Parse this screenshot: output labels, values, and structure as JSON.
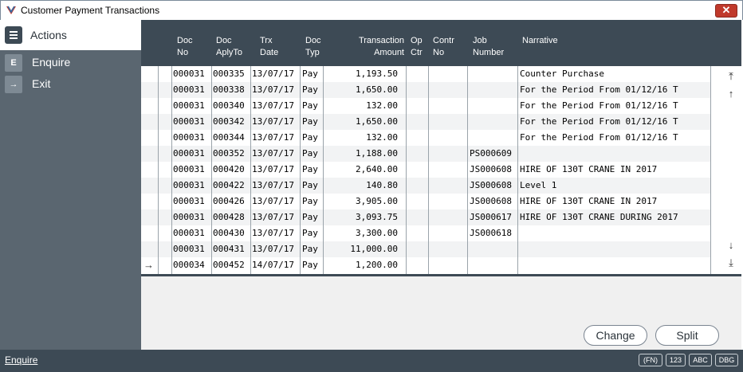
{
  "window": {
    "title": "Customer Payment Transactions",
    "close_glyph": "✕"
  },
  "sidebar": {
    "header": "Actions",
    "items": [
      {
        "label": "Enquire",
        "icon": "E"
      },
      {
        "label": "Exit",
        "icon": "→"
      }
    ]
  },
  "grid": {
    "columns": [
      {
        "line1": "Doc",
        "line2": "No"
      },
      {
        "line1": "Doc",
        "line2": "AplyTo"
      },
      {
        "line1": "Trx",
        "line2": "Date"
      },
      {
        "line1": "Doc",
        "line2": "Typ"
      },
      {
        "line1": "Transaction",
        "line2": "Amount"
      },
      {
        "line1": "Op",
        "line2": "Ctr"
      },
      {
        "line1": "Contr",
        "line2": "No"
      },
      {
        "line1": "Job",
        "line2": "Number"
      },
      {
        "line1": "Narrative",
        "line2": ""
      }
    ],
    "rows": [
      {
        "doc_no": "000031",
        "aply_to": "000335",
        "date": "13/07/17",
        "type": "Pay",
        "amount": "1,193.50",
        "op": "",
        "contr": "",
        "job": "",
        "narrative": "Counter Purchase"
      },
      {
        "doc_no": "000031",
        "aply_to": "000338",
        "date": "13/07/17",
        "type": "Pay",
        "amount": "1,650.00",
        "op": "",
        "contr": "",
        "job": "",
        "narrative": "For the Period From 01/12/16 T"
      },
      {
        "doc_no": "000031",
        "aply_to": "000340",
        "date": "13/07/17",
        "type": "Pay",
        "amount": "132.00",
        "op": "",
        "contr": "",
        "job": "",
        "narrative": "For the Period From 01/12/16 T"
      },
      {
        "doc_no": "000031",
        "aply_to": "000342",
        "date": "13/07/17",
        "type": "Pay",
        "amount": "1,650.00",
        "op": "",
        "contr": "",
        "job": "",
        "narrative": "For the Period From 01/12/16 T"
      },
      {
        "doc_no": "000031",
        "aply_to": "000344",
        "date": "13/07/17",
        "type": "Pay",
        "amount": "132.00",
        "op": "",
        "contr": "",
        "job": "",
        "narrative": "For the Period From 01/12/16 T"
      },
      {
        "doc_no": "000031",
        "aply_to": "000352",
        "date": "13/07/17",
        "type": "Pay",
        "amount": "1,188.00",
        "op": "",
        "contr": "",
        "job": "PS000609",
        "narrative": ""
      },
      {
        "doc_no": "000031",
        "aply_to": "000420",
        "date": "13/07/17",
        "type": "Pay",
        "amount": "2,640.00",
        "op": "",
        "contr": "",
        "job": "JS000608",
        "narrative": "HIRE OF 130T CRANE IN 2017"
      },
      {
        "doc_no": "000031",
        "aply_to": "000422",
        "date": "13/07/17",
        "type": "Pay",
        "amount": "140.80",
        "op": "",
        "contr": "",
        "job": "JS000608",
        "narrative": "Level 1"
      },
      {
        "doc_no": "000031",
        "aply_to": "000426",
        "date": "13/07/17",
        "type": "Pay",
        "amount": "3,905.00",
        "op": "",
        "contr": "",
        "job": "JS000608",
        "narrative": "HIRE OF 130T CRANE IN 2017"
      },
      {
        "doc_no": "000031",
        "aply_to": "000428",
        "date": "13/07/17",
        "type": "Pay",
        "amount": "3,093.75",
        "op": "",
        "contr": "",
        "job": "JS000617",
        "narrative": "HIRE OF 130T CRANE DURING 2017"
      },
      {
        "doc_no": "000031",
        "aply_to": "000430",
        "date": "13/07/17",
        "type": "Pay",
        "amount": "3,300.00",
        "op": "",
        "contr": "",
        "job": "JS000618",
        "narrative": ""
      },
      {
        "doc_no": "000031",
        "aply_to": "000431",
        "date": "13/07/17",
        "type": "Pay",
        "amount": "11,000.00",
        "op": "",
        "contr": "",
        "job": "",
        "narrative": ""
      },
      {
        "doc_no": "000034",
        "aply_to": "000452",
        "date": "14/07/17",
        "type": "Pay",
        "amount": "1,200.00",
        "op": "",
        "contr": "",
        "job": "",
        "narrative": ""
      }
    ],
    "current_row_marker": "→",
    "scroll_icons": {
      "top": "⤒",
      "up": "↑",
      "down": "↓",
      "bottom": "⤓"
    }
  },
  "buttons": {
    "change": "Change",
    "split": "Split"
  },
  "statusbar": {
    "text": "Enquire",
    "badges": [
      "(FN)",
      "123",
      "ABC",
      "DBG"
    ]
  },
  "colors": {
    "header_bg": "#3d4a55",
    "sidebar_bg": "#5a6670",
    "close_btn": "#c0392b"
  }
}
